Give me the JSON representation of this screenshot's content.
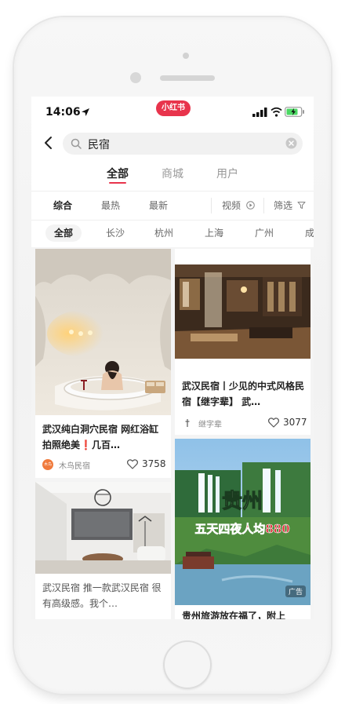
{
  "status_bar": {
    "time": "14:06",
    "brand": "小红书"
  },
  "search": {
    "query": "民宿"
  },
  "tabs": [
    {
      "label": "全部",
      "active": true
    },
    {
      "label": "商城",
      "active": false
    },
    {
      "label": "用户",
      "active": false
    }
  ],
  "sort": [
    {
      "label": "综合",
      "active": true
    },
    {
      "label": "最热",
      "active": false
    },
    {
      "label": "最新",
      "active": false
    }
  ],
  "sort_right": {
    "video_label": "视频",
    "filter_label": "筛选"
  },
  "cities": [
    {
      "label": "全部",
      "active": true
    },
    {
      "label": "长沙",
      "active": false
    },
    {
      "label": "杭州",
      "active": false
    },
    {
      "label": "上海",
      "active": false
    },
    {
      "label": "广州",
      "active": false
    },
    {
      "label": "成",
      "active": false
    }
  ],
  "cards": [
    {
      "title": "武汉纯白洞穴民宿 网红浴缸拍照绝美❗️几百…",
      "author": "木鸟民宿",
      "avatar_text": "木鸟",
      "likes": "3758"
    },
    {
      "title": "武汉民宿丨少见的中式风格民宿【继字辈】 武…",
      "author": "继字辈",
      "likes": "3077"
    },
    {
      "title": "武汉民宿 推一款武汉民宿 很有高级感。我个…"
    },
    {
      "title": "贵州旅游放在福了，附上",
      "ad_label": "广告",
      "image_text": {
        "line1": "贵州",
        "line2": "五天四夜人均880"
      }
    }
  ],
  "colors": {
    "brand": "#e8344c",
    "feed_bg": "#f4f4f4",
    "avatar_orange": "#f07a3c"
  }
}
